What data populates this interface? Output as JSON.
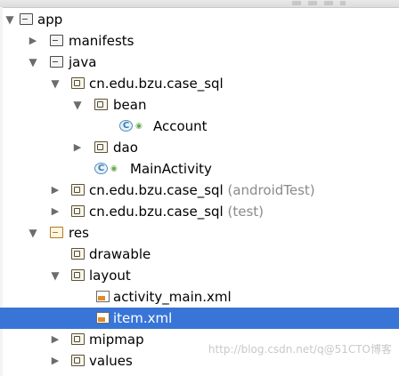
{
  "tree": {
    "app": "app",
    "manifests": "manifests",
    "java": "java",
    "pkg_main": "cn.edu.bzu.case_sql",
    "bean": "bean",
    "account": "Account",
    "dao": "dao",
    "main_activity": "MainActivity",
    "pkg_android_test": "cn.edu.bzu.case_sql",
    "android_test_suffix": "(androidTest)",
    "pkg_test": "cn.edu.bzu.case_sql",
    "test_suffix": "(test)",
    "res": "res",
    "drawable": "drawable",
    "layout": "layout",
    "activity_main_xml": "activity_main.xml",
    "item_xml": "item.xml",
    "mipmap": "mipmap",
    "values": "values"
  },
  "watermark": "http://blog.csdn.net/q@51CTO博客",
  "colors": {
    "selection": "#3875d7",
    "suffix": "#8a8a8a"
  }
}
